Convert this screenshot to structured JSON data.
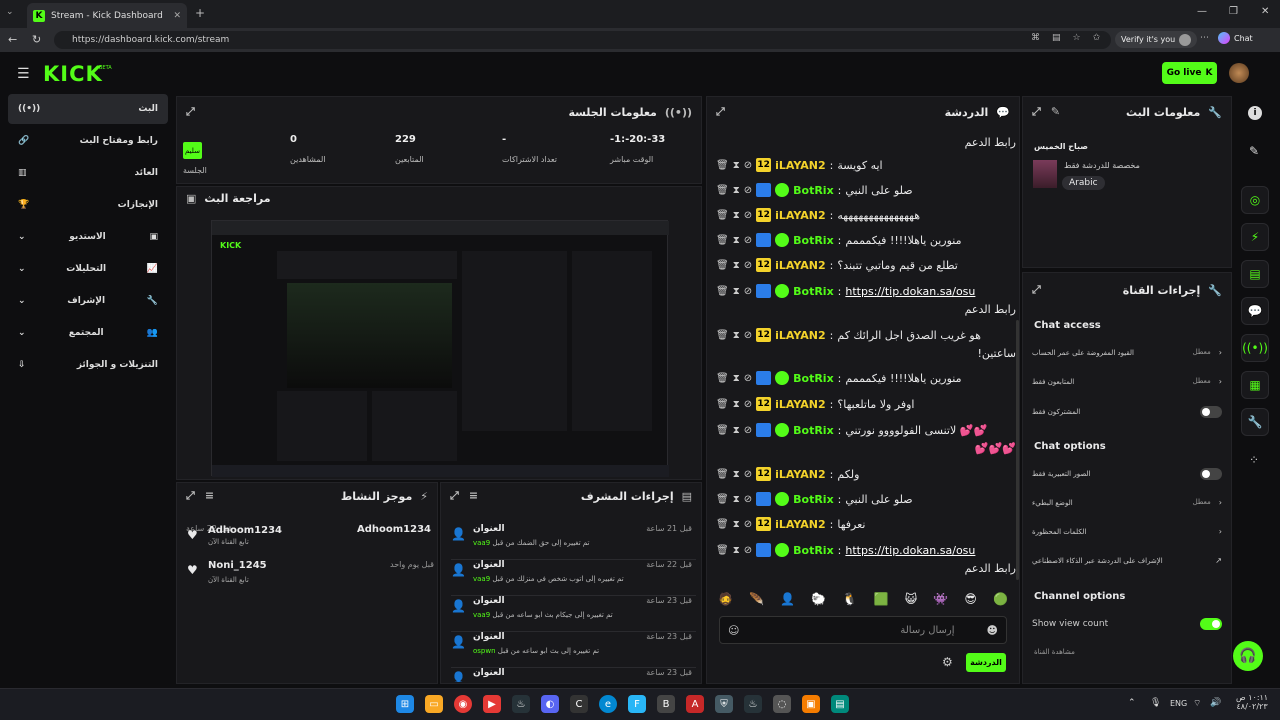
{
  "browser": {
    "tab_title": "Stream - Kick Dashboard",
    "url": "https://dashboard.kick.com/stream",
    "verify": "Verify it's you",
    "chat_btn": "Chat"
  },
  "header": {
    "logo": "KICK",
    "beta": "BETA",
    "go_live": "Go live"
  },
  "nav": [
    {
      "label": "البث"
    },
    {
      "label": "رابط ومفتاح البث"
    },
    {
      "label": "العائد"
    },
    {
      "label": "الإنجازات"
    },
    {
      "label": "الاستديو"
    },
    {
      "label": "التحليلات"
    },
    {
      "label": "الإشراف"
    },
    {
      "label": "المجتمع"
    },
    {
      "label": "التنزيلات و الجوائز"
    }
  ],
  "session": {
    "title": "معلومات الجلسة",
    "health": "سليم",
    "health_label": "الجلسة",
    "viewers_value": "0",
    "viewers_label": "المشاهدين",
    "followers_value": "229",
    "followers_label": "المتابعين",
    "subs_value": "-",
    "subs_label": "تعداد الاشتراكات",
    "time_value": "-1:-20:-33",
    "time_label": "الوقت مباشر"
  },
  "preview": {
    "title": "مراجعة البث"
  },
  "activity": {
    "title": "موجز النشاط",
    "items": [
      {
        "name": "Adhoom1234",
        "sub": "تابع القناة الآن",
        "time": "قبل 22 ساعة"
      },
      {
        "name": "Noni_1245",
        "sub": "تابع القناة الآن",
        "time": "قبل يوم واحد"
      }
    ]
  },
  "modactions": {
    "title": "إجراءات المشرف",
    "items": [
      {
        "head": "العنوان",
        "desc": "تم تغييره إلى حق الضمك من قبل",
        "user": "vaa9",
        "time": "قبل 21 ساعة"
      },
      {
        "head": "العنوان",
        "desc": "تم تغييره إلى اتوب شخص في منزلك من قبل",
        "user": "vaa9",
        "time": "قبل 22 ساعة"
      },
      {
        "head": "العنوان",
        "desc": "تم تغييره إلى جيكام بث ابو ساعه من قبل",
        "user": "vaa9",
        "time": "قبل 23 ساعة"
      },
      {
        "head": "العنوان",
        "desc": "تم تغييره إلى بث ابو ساعه من قبل",
        "user": "ospwn",
        "time": "قبل 23 ساعة"
      },
      {
        "head": "العنوان",
        "desc": "",
        "user": "",
        "time": "قبل 23 ساعة"
      }
    ]
  },
  "chat": {
    "title": "الدردشة",
    "top_text": "رابط الدعم",
    "placeholder": "إرسال رسالة",
    "send": "الدردشة",
    "messages": [
      {
        "user": "iLAYAN2",
        "text": "ايه كويسة",
        "bot": false
      },
      {
        "user": "BotRix",
        "text": "صلو على النبي",
        "bot": true
      },
      {
        "user": "iLAYAN2",
        "text": "هههههههههههههههه",
        "bot": false
      },
      {
        "user": "BotRix",
        "text": "منورين ياهلا!!!! فيكمممم",
        "bot": true
      },
      {
        "user": "iLAYAN2",
        "text": "تطلع من قيم وماتبي تتبند؟",
        "bot": false
      },
      {
        "user": "BotRix",
        "text": "https://tip.dokan.sa/osu",
        "bot": true,
        "link": true,
        "after": "رابط الدعم"
      },
      {
        "user": "iLAYAN2",
        "text": "هو غريب الصدق اجل الرائك كم",
        "bot": false,
        "after": "ساعتين!"
      },
      {
        "user": "BotRix",
        "text": "منورين ياهلا!!!! فيكمممم",
        "bot": true
      },
      {
        "user": "iLAYAN2",
        "text": "اوفر ولا ماتلعبها؟",
        "bot": false
      },
      {
        "user": "BotRix",
        "text": "لاتنسى الفولوووو نورتني 💕💕",
        "bot": true,
        "after": "💕💕💕"
      },
      {
        "user": "iLAYAN2",
        "text": "ولكم",
        "bot": false
      },
      {
        "user": "BotRix",
        "text": "صلو على النبي",
        "bot": true
      },
      {
        "user": "iLAYAN2",
        "text": "نعرفها",
        "bot": false
      },
      {
        "user": "BotRix",
        "text": "https://tip.dokan.sa/osu",
        "bot": true,
        "link": true,
        "after": "رابط الدعم"
      }
    ]
  },
  "streaminfo": {
    "title": "معلومات البث",
    "stream_title": "صباح الخميس",
    "desc": "مخصصة للدردشة فقط",
    "tag": "Arabic"
  },
  "channel": {
    "title": "إجراءات القناة",
    "chat_access": "Chat access",
    "acc1": "القيود المفروضة على عمر الحساب",
    "acc1_val": "معطل",
    "acc2": "المتابعون فقط",
    "acc2_val": "معطل",
    "acc3": "المشتركون فقط",
    "chat_options": "Chat options",
    "opt1": "الصور التعبيرية فقط",
    "opt2": "الوضع البطيء",
    "opt2_val": "معطل",
    "opt3": "الكلمات المحظورة",
    "opt4": "الإشراف على الدردشة عبر الذكاء الاصطناعي",
    "channel_options": "Channel options",
    "show_view": "Show view count",
    "more": "مشاهدة القناة"
  },
  "taskbar": {
    "lang": "ENG",
    "time": "١٠:١١ ص",
    "date": "٤٨/٠٢/٢٣"
  }
}
